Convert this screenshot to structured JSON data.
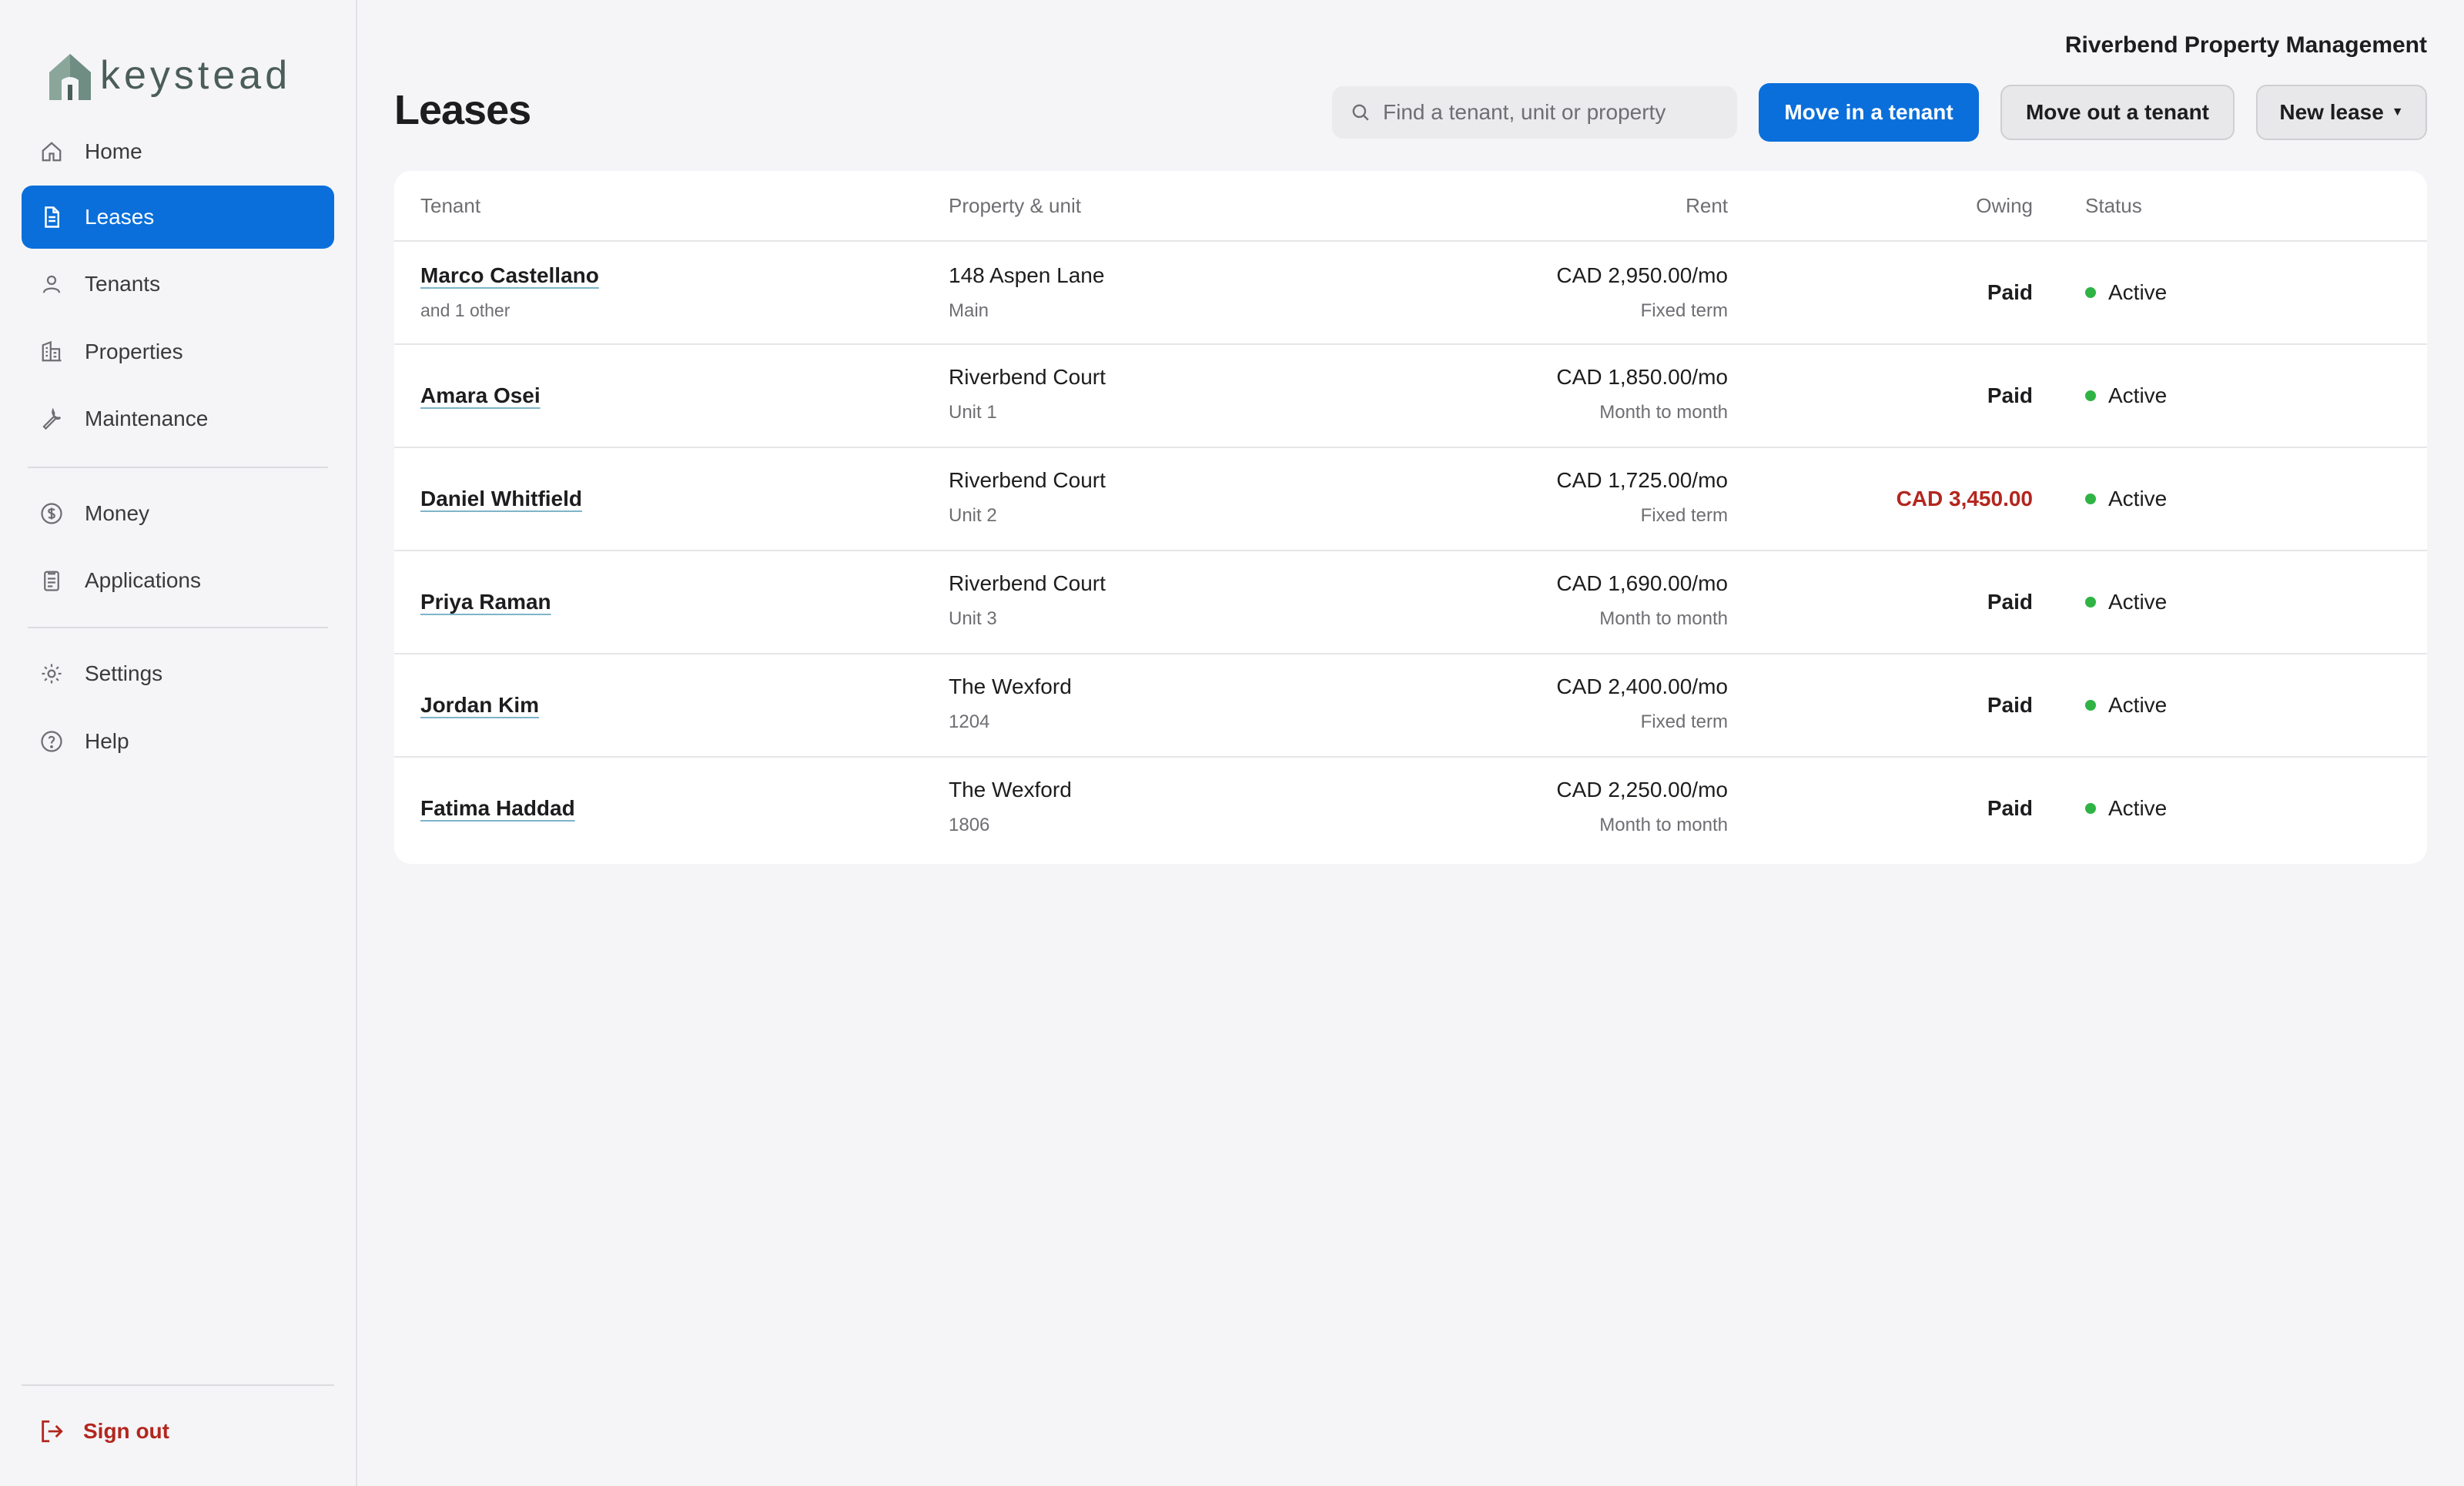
{
  "brand": {
    "name": "keystead",
    "accent": "#0a6fdb"
  },
  "org_name": "Riverbend Property Management",
  "sidebar": {
    "items": [
      {
        "label": "Home",
        "icon": "home-icon"
      },
      {
        "label": "Leases",
        "icon": "document-icon",
        "active": true
      },
      {
        "label": "Tenants",
        "icon": "person-icon"
      },
      {
        "label": "Properties",
        "icon": "building-icon"
      },
      {
        "label": "Maintenance",
        "icon": "wrench-icon"
      },
      {
        "label": "Money",
        "icon": "dollar-circle-icon"
      },
      {
        "label": "Applications",
        "icon": "clipboard-icon"
      },
      {
        "label": "Settings",
        "icon": "gear-icon"
      },
      {
        "label": "Help",
        "icon": "question-circle-icon"
      }
    ],
    "signout_label": "Sign out"
  },
  "header": {
    "title": "Leases",
    "search_placeholder": "Find a tenant, unit or property",
    "move_in_label": "Move in a tenant",
    "move_out_label": "Move out a tenant",
    "new_lease_label": "New lease"
  },
  "table": {
    "columns": {
      "tenant": "Tenant",
      "property": "Property & unit",
      "rent": "Rent",
      "owing": "Owing",
      "status": "Status"
    },
    "rows": [
      {
        "tenant": "Marco Castellano",
        "tenant_sub": "and 1 other",
        "property": "148 Aspen Lane",
        "unit": "Main",
        "rent": "CAD 2,950.00/mo",
        "term": "Fixed term",
        "owing": "Paid",
        "owing_color": "#1d1d1f",
        "status": "Active"
      },
      {
        "tenant": "Amara Osei",
        "tenant_sub": "",
        "property": "Riverbend Court",
        "unit": "Unit 1",
        "rent": "CAD 1,850.00/mo",
        "term": "Month to month",
        "owing": "Paid",
        "owing_color": "#1d1d1f",
        "status": "Active"
      },
      {
        "tenant": "Daniel Whitfield",
        "tenant_sub": "",
        "property": "Riverbend Court",
        "unit": "Unit 2",
        "rent": "CAD 1,725.00/mo",
        "term": "Fixed term",
        "owing": "CAD 3,450.00",
        "owing_color": "#b3261e",
        "status": "Active"
      },
      {
        "tenant": "Priya Raman",
        "tenant_sub": "",
        "property": "Riverbend Court",
        "unit": "Unit 3",
        "rent": "CAD 1,690.00/mo",
        "term": "Month to month",
        "owing": "Paid",
        "owing_color": "#1d1d1f",
        "status": "Active"
      },
      {
        "tenant": "Jordan Kim",
        "tenant_sub": "",
        "property": "The Wexford",
        "unit": "1204",
        "rent": "CAD 2,400.00/mo",
        "term": "Fixed term",
        "owing": "Paid",
        "owing_color": "#1d1d1f",
        "status": "Active"
      },
      {
        "tenant": "Fatima Haddad",
        "tenant_sub": "",
        "property": "The Wexford",
        "unit": "1806",
        "rent": "CAD 2,250.00/mo",
        "term": "Month to month",
        "owing": "Paid",
        "owing_color": "#1d1d1f",
        "status": "Active"
      }
    ]
  }
}
